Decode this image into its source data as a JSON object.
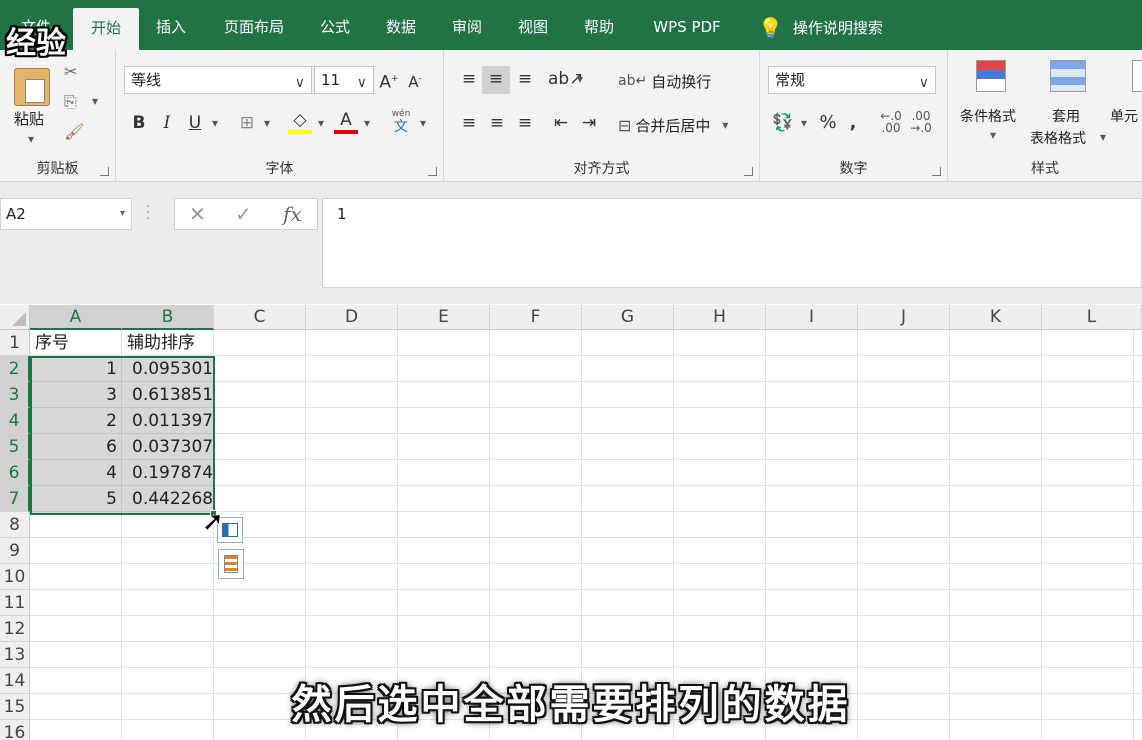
{
  "tabs": [
    "文件",
    "开始",
    "插入",
    "页面布局",
    "公式",
    "数据",
    "审阅",
    "视图",
    "帮助",
    "WPS PDF"
  ],
  "tell_me": "操作说明搜索",
  "watermark": "经验",
  "clipboard": {
    "paste": "粘贴",
    "label": "剪贴板"
  },
  "font": {
    "name": "等线",
    "size": "11",
    "bold": "B",
    "italic": "I",
    "underline": "U",
    "label": "字体",
    "wen": "wén",
    "wen_char": "文"
  },
  "alignment": {
    "wrap": "自动换行",
    "merge": "合并后居中",
    "label": "对齐方式"
  },
  "number": {
    "format": "常规",
    "label": "数字",
    "percent": "%",
    "comma": ","
  },
  "styles": {
    "conditional": "条件格式",
    "table_line1": "套用",
    "table_line2": "表格格式",
    "cell": "单元",
    "label": "样式"
  },
  "formula_bar": {
    "name_box": "A2",
    "fx": "fx",
    "value": "1"
  },
  "columns": [
    "A",
    "B",
    "C",
    "D",
    "E",
    "F",
    "G",
    "H",
    "I",
    "J",
    "K",
    "L"
  ],
  "rows": [
    "1",
    "2",
    "3",
    "4",
    "5",
    "6",
    "7",
    "8",
    "9",
    "10",
    "11",
    "12",
    "13",
    "14",
    "15",
    "16"
  ],
  "sheet": {
    "header": [
      "序号",
      "辅助排序"
    ],
    "data": [
      [
        "1",
        "0.095301"
      ],
      [
        "3",
        "0.613851"
      ],
      [
        "2",
        "0.011397"
      ],
      [
        "6",
        "0.037307"
      ],
      [
        "4",
        "0.197874"
      ],
      [
        "5",
        "0.442268"
      ]
    ]
  },
  "subtitle": "然后选中全部需要排列的数据",
  "colors": {
    "excel_green": "#217346",
    "ribbon_bg": "#f3f3f3"
  }
}
